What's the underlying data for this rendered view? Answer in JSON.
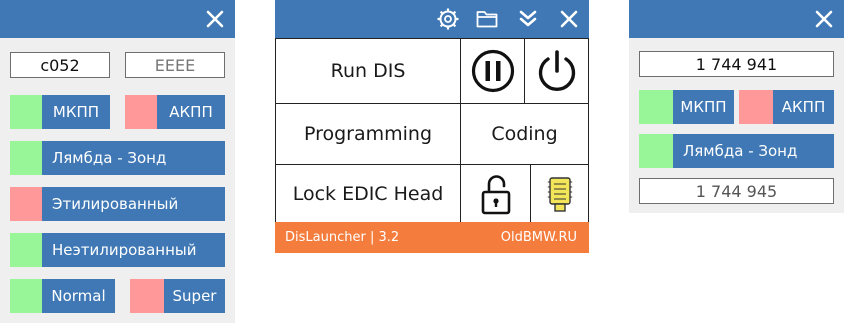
{
  "colors": {
    "accent": "#3f78b5",
    "on": "#98f598",
    "off": "#ff9999",
    "footer": "#f47c3c",
    "key": "#f3e55a"
  },
  "left_panel": {
    "code_value": "c052",
    "code_placeholder": "EEEE",
    "buttons": {
      "mkpp": "МКПП",
      "akpp": "АКПП",
      "lambda": "Лямбда - Зонд",
      "leaded": "Этилированный",
      "unleaded": "Неэтилированный",
      "normal": "Normal",
      "super": "Super"
    },
    "icons": {
      "close": "close-icon"
    }
  },
  "main_window": {
    "toolbar_icons": [
      "gear-icon",
      "folder-icon",
      "chevrons-down-icon",
      "close-icon"
    ],
    "run_label": "Run DIS",
    "programming_label": "Programming",
    "coding_label": "Coding",
    "lock_label": "Lock EDIC Head",
    "icons": {
      "pause": "pause-icon",
      "power": "power-icon",
      "unlock": "unlock-icon",
      "key": "key-icon"
    },
    "footer_left": "DisLauncher | 3.2",
    "footer_right": "OldBMW.RU"
  },
  "right_panel": {
    "value_top": "1 744 941",
    "value_bottom": "1 744 945",
    "buttons": {
      "mkpp": "МКПП",
      "akpp": "АКПП",
      "lambda": "Лямбда - Зонд"
    },
    "icons": {
      "close": "close-icon"
    }
  }
}
